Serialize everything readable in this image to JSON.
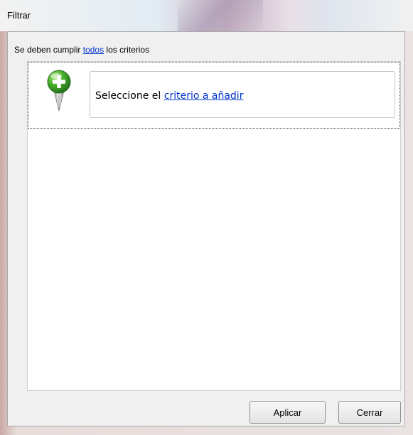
{
  "window": {
    "title": "Filtrar"
  },
  "criteria_line": {
    "prefix": "Se deben cumplir ",
    "link": "todos",
    "suffix": " los criterios"
  },
  "criterion": {
    "icon": "add-plus-icon",
    "prefix": "Seleccione el ",
    "link": "criterio a añadir"
  },
  "buttons": {
    "apply": "Aplicar",
    "close": "Cerrar"
  },
  "colors": {
    "link": "#0033cc",
    "icon_green": "#3aa023"
  }
}
